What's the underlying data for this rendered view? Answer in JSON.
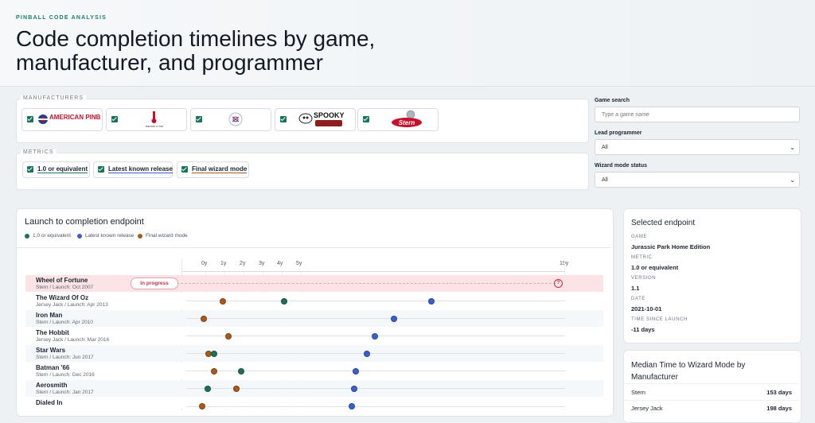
{
  "header": {
    "eyebrow": "PINBALL CODE ANALYSIS",
    "title": "Code completion timelines by game, manufacturer, and programmer"
  },
  "filters": {
    "manufacturers_legend": "MANUFACTURERS",
    "manufacturers": [
      {
        "name": "American Pinball",
        "logo_text": "AMERICAN PINBALL",
        "checked": true
      },
      {
        "name": "Barrels of Fun",
        "logo_text": "barrels o fun",
        "checked": true
      },
      {
        "name": "Chicago Gaming",
        "logo_text": "",
        "checked": true
      },
      {
        "name": "Spooky Pinball",
        "logo_text": "SPOOKY",
        "checked": true
      },
      {
        "name": "Stern",
        "logo_text": "Stern",
        "checked": true
      }
    ],
    "metrics_legend": "METRICS",
    "metrics": [
      {
        "label": "1.0 or equivalent",
        "color": "#1f6f5c",
        "checked": true
      },
      {
        "label": "Latest known release",
        "color": "#3a5fcd",
        "checked": true
      },
      {
        "label": "Final wizard mode",
        "color": "#a85a1c",
        "checked": true
      }
    ],
    "game_search_label": "Game search",
    "game_search_placeholder": "Type a game name",
    "lead_programmer_label": "Lead programmer",
    "lead_programmer_value": "All",
    "wizard_status_label": "Wizard mode status",
    "wizard_status_value": "All"
  },
  "timeline": {
    "title": "Launch to completion endpoint",
    "legend": [
      {
        "label": "1.0 or equivalent",
        "color": "#1f6f5c"
      },
      {
        "label": "Latest known release",
        "color": "#3a5fcd"
      },
      {
        "label": "Final wizard mode",
        "color": "#a85a1c"
      }
    ],
    "ticks": [
      "0y",
      "1y",
      "2y",
      "3y",
      "4y",
      "5y",
      "19y"
    ],
    "in_progress_label": "In progress",
    "unknown_glyph": "?",
    "rows": [
      {
        "name": "Wheel of Fortune",
        "sub": "Stern / Launch: Oct 2007",
        "highlight": true,
        "in_progress": true
      },
      {
        "name": "The Wizard Of Oz",
        "sub": "Jersey Jack / Launch: Apr 2013"
      },
      {
        "name": "Iron Man",
        "sub": "Stern / Launch: Apr 2010"
      },
      {
        "name": "The Hobbit",
        "sub": "Jersey Jack / Launch: Mar 2016"
      },
      {
        "name": "Star Wars",
        "sub": "Stern / Launch: Jun 2017"
      },
      {
        "name": "Batman '66",
        "sub": "Stern / Launch: Dec 2016"
      },
      {
        "name": "Aerosmith",
        "sub": "Stern / Launch: Jan 2017"
      },
      {
        "name": "Dialed In",
        "sub": ""
      }
    ]
  },
  "selected": {
    "title": "Selected endpoint",
    "game_label": "GAME",
    "game": "Jurassic Park Home Edition",
    "metric_label": "METRIC",
    "metric": "1.0 or equivalent",
    "version_label": "VERSION",
    "version": "1.1",
    "date_label": "DATE",
    "date": "2021-10-01",
    "since_label": "TIME SINCE LAUNCH",
    "since": "-11 days"
  },
  "median": {
    "title": "Median Time to Wizard Mode by Manufacturer",
    "rows": [
      {
        "name": "Stern",
        "value": "153 days"
      },
      {
        "name": "Jersey Jack",
        "value": "198 days"
      }
    ]
  }
}
